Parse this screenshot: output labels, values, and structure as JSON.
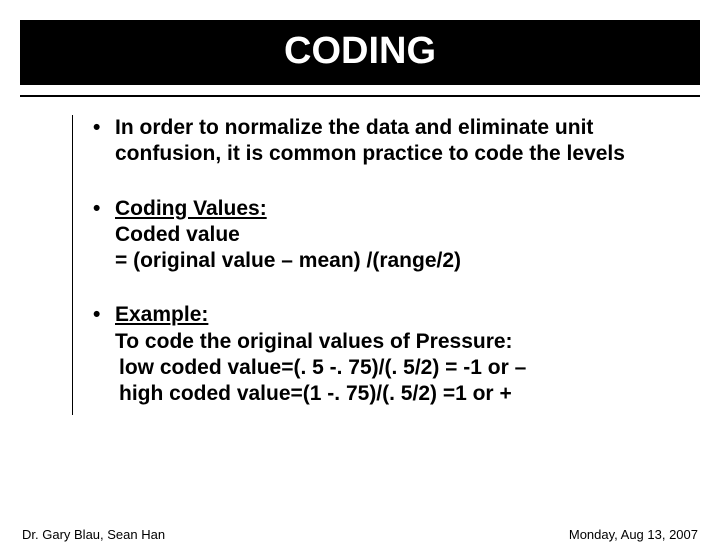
{
  "title": "CODING",
  "bullets": {
    "b1": {
      "text": "In order to normalize the data and eliminate unit confusion, it is common practice to code the levels"
    },
    "b2": {
      "heading": "Coding  Values:",
      "line1": "Coded value",
      "line2": "=  (original value – mean) /(range/2)"
    },
    "b3": {
      "heading": "Example:",
      "line1": "To code the original values of Pressure:",
      "line2": " low coded value=(. 5 -. 75)/(. 5/2) = -1  or –",
      "line3": " high coded value=(1 -. 75)/(. 5/2) =1   or  +"
    }
  },
  "footer": {
    "left": "Dr. Gary Blau, Sean Han",
    "right": "Monday, Aug 13, 2007"
  }
}
